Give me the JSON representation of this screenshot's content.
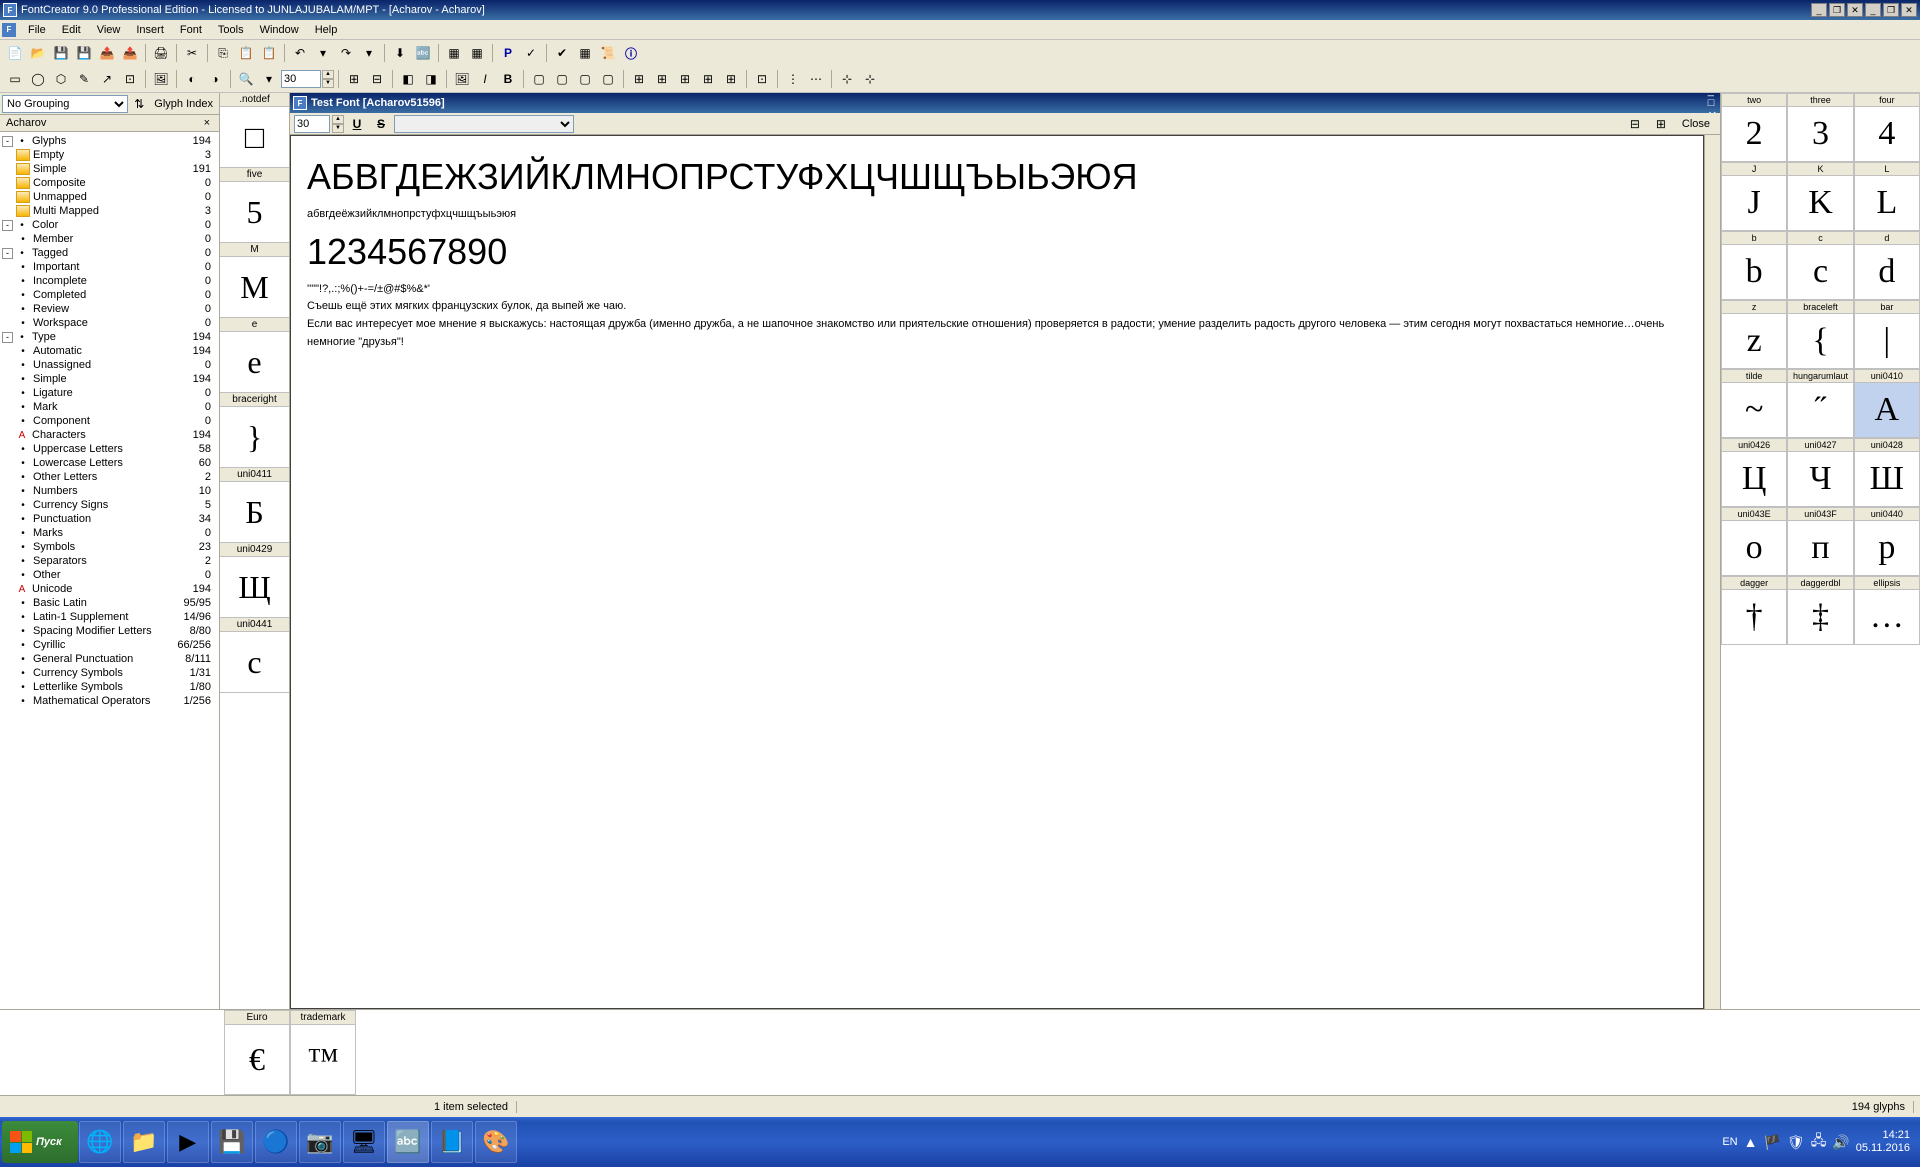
{
  "titlebar": {
    "title": "FontCreator 9.0 Professional Edition - Licensed to JUNLAJUBALAM/MPT - [Acharov - Acharov]"
  },
  "menubar": {
    "items": [
      "File",
      "Edit",
      "View",
      "Insert",
      "Font",
      "Tools",
      "Window",
      "Help"
    ]
  },
  "leftPanel": {
    "groupingSelect": "No Grouping",
    "sortLabel": "Glyph Index",
    "tabName": "Acharov",
    "tree": [
      {
        "label": "Glyphs",
        "count": "194",
        "type": "root",
        "toggle": "-"
      },
      {
        "label": "Empty",
        "count": "3",
        "type": "folder",
        "indent": 1
      },
      {
        "label": "Simple",
        "count": "191",
        "type": "folder",
        "indent": 1
      },
      {
        "label": "Composite",
        "count": "0",
        "type": "folder",
        "indent": 1
      },
      {
        "label": "Unmapped",
        "count": "0",
        "type": "folder",
        "indent": 1
      },
      {
        "label": "Multi Mapped",
        "count": "3",
        "type": "folder",
        "indent": 1
      },
      {
        "label": "Color",
        "count": "0",
        "type": "root",
        "toggle": "-"
      },
      {
        "label": "Member",
        "count": "0",
        "type": "sub",
        "indent": 1
      },
      {
        "label": "Tagged",
        "count": "0",
        "type": "root",
        "toggle": "-"
      },
      {
        "label": "Important",
        "count": "0",
        "type": "sub",
        "indent": 1
      },
      {
        "label": "Incomplete",
        "count": "0",
        "type": "sub",
        "indent": 1
      },
      {
        "label": "Completed",
        "count": "0",
        "type": "sub",
        "indent": 1
      },
      {
        "label": "Review",
        "count": "0",
        "type": "sub",
        "indent": 1
      },
      {
        "label": "Workspace",
        "count": "0",
        "type": "sub",
        "indent": 1
      },
      {
        "label": "Type",
        "count": "194",
        "type": "root",
        "toggle": "-"
      },
      {
        "label": "Automatic",
        "count": "194",
        "type": "sub",
        "indent": 1
      },
      {
        "label": "Unassigned",
        "count": "0",
        "type": "sub",
        "indent": 1
      },
      {
        "label": "Simple",
        "count": "194",
        "type": "sub",
        "indent": 1
      },
      {
        "label": "Ligature",
        "count": "0",
        "type": "sub",
        "indent": 1
      },
      {
        "label": "Mark",
        "count": "0",
        "type": "sub",
        "indent": 1
      },
      {
        "label": "Component",
        "count": "0",
        "type": "sub",
        "indent": 1
      },
      {
        "label": "Characters",
        "count": "194",
        "type": "header"
      },
      {
        "label": "Uppercase Letters",
        "count": "58",
        "type": "sub",
        "indent": 1
      },
      {
        "label": "Lowercase Letters",
        "count": "60",
        "type": "sub",
        "indent": 1
      },
      {
        "label": "Other Letters",
        "count": "2",
        "type": "sub",
        "indent": 1
      },
      {
        "label": "Numbers",
        "count": "10",
        "type": "sub",
        "indent": 1
      },
      {
        "label": "Currency Signs",
        "count": "5",
        "type": "sub",
        "indent": 1
      },
      {
        "label": "Punctuation",
        "count": "34",
        "type": "sub",
        "indent": 1
      },
      {
        "label": "Marks",
        "count": "0",
        "type": "sub",
        "indent": 1
      },
      {
        "label": "Symbols",
        "count": "23",
        "type": "sub",
        "indent": 1
      },
      {
        "label": "Separators",
        "count": "2",
        "type": "sub",
        "indent": 1
      },
      {
        "label": "Other",
        "count": "0",
        "type": "sub",
        "indent": 1
      },
      {
        "label": "Unicode",
        "count": "194",
        "type": "header"
      },
      {
        "label": "Basic Latin",
        "count": "95/95",
        "type": "sub",
        "indent": 1
      },
      {
        "label": "Latin-1 Supplement",
        "count": "14/96",
        "type": "sub",
        "indent": 1
      },
      {
        "label": "Spacing Modifier Letters",
        "count": "8/80",
        "type": "sub",
        "indent": 1
      },
      {
        "label": "Cyrillic",
        "count": "66/256",
        "type": "sub",
        "indent": 1
      },
      {
        "label": "General Punctuation",
        "count": "8/111",
        "type": "sub",
        "indent": 1
      },
      {
        "label": "Currency Symbols",
        "count": "1/31",
        "type": "sub",
        "indent": 1
      },
      {
        "label": "Letterlike Symbols",
        "count": "1/80",
        "type": "sub",
        "indent": 1
      },
      {
        "label": "Mathematical Operators",
        "count": "1/256",
        "type": "sub",
        "indent": 1
      }
    ]
  },
  "glyphCol": [
    {
      "name": ".notdef",
      "glyph": "□"
    },
    {
      "name": "five",
      "glyph": "5"
    },
    {
      "name": "M",
      "glyph": "М"
    },
    {
      "name": "e",
      "glyph": "е"
    },
    {
      "name": "braceright",
      "glyph": "}"
    },
    {
      "name": "uni0411",
      "glyph": "Б"
    },
    {
      "name": "uni0429",
      "glyph": "Щ"
    },
    {
      "name": "uni0441",
      "glyph": "с"
    }
  ],
  "bottomGlyphs": [
    {
      "name": "Euro",
      "glyph": "€"
    },
    {
      "name": "trademark",
      "glyph": "™"
    }
  ],
  "doc": {
    "title": "Test Font [Acharov51596]",
    "pointSize": "30",
    "closeLabel": "Close",
    "text": {
      "line1": "АБВГДЕЖЗИЙКЛМНОПРСТУФХЦЧШЩЪЫЬЭЮЯ",
      "line2": "абвгдеёжзийклмнопрстуфхцчшщъыьэюя",
      "line3": "1234567890",
      "line4": "''\"\"!?,.:;%()+-=/±@#$%&*'",
      "line5": "Съешь ещё этих мягких французских булок, да выпей же чаю.",
      "line6": "Если вас интересует мое мнение я выскажусь: настоящая дружба (именно дружба, а не шапочное знакомство или приятельские отношения) проверяется в радости; умение разделить радость другого человека — этим сегодня могут похвастаться немногие…очень немногие \"друзья\"!"
    }
  },
  "rightGrid": [
    {
      "name": "two",
      "glyph": "2"
    },
    {
      "name": "three",
      "glyph": "3"
    },
    {
      "name": "four",
      "glyph": "4"
    },
    {
      "name": "J",
      "glyph": "J"
    },
    {
      "name": "K",
      "glyph": "K"
    },
    {
      "name": "L",
      "glyph": "L"
    },
    {
      "name": "b",
      "glyph": "b"
    },
    {
      "name": "c",
      "glyph": "c"
    },
    {
      "name": "d",
      "glyph": "d"
    },
    {
      "name": "z",
      "glyph": "z"
    },
    {
      "name": "braceleft",
      "glyph": "{"
    },
    {
      "name": "bar",
      "glyph": "|"
    },
    {
      "name": "tilde",
      "glyph": "~"
    },
    {
      "name": "hungarumlaut",
      "glyph": "˝"
    },
    {
      "name": "uni0410",
      "glyph": "А",
      "sel": true
    },
    {
      "name": "uni0426",
      "glyph": "Ц"
    },
    {
      "name": "uni0427",
      "glyph": "Ч"
    },
    {
      "name": "uni0428",
      "glyph": "Ш"
    },
    {
      "name": "uni043E",
      "glyph": "о"
    },
    {
      "name": "uni043F",
      "glyph": "п"
    },
    {
      "name": "uni0440",
      "glyph": "р"
    },
    {
      "name": "dagger",
      "glyph": "†"
    },
    {
      "name": "daggerdbl",
      "glyph": "‡"
    },
    {
      "name": "ellipsis",
      "glyph": "…"
    }
  ],
  "statusbar": {
    "selected": "1 item selected",
    "glyphs": "194 glyphs"
  },
  "taskbar": {
    "start": "Пуск",
    "lang": "EN",
    "time": "14:21",
    "date": "05.11.2016"
  }
}
